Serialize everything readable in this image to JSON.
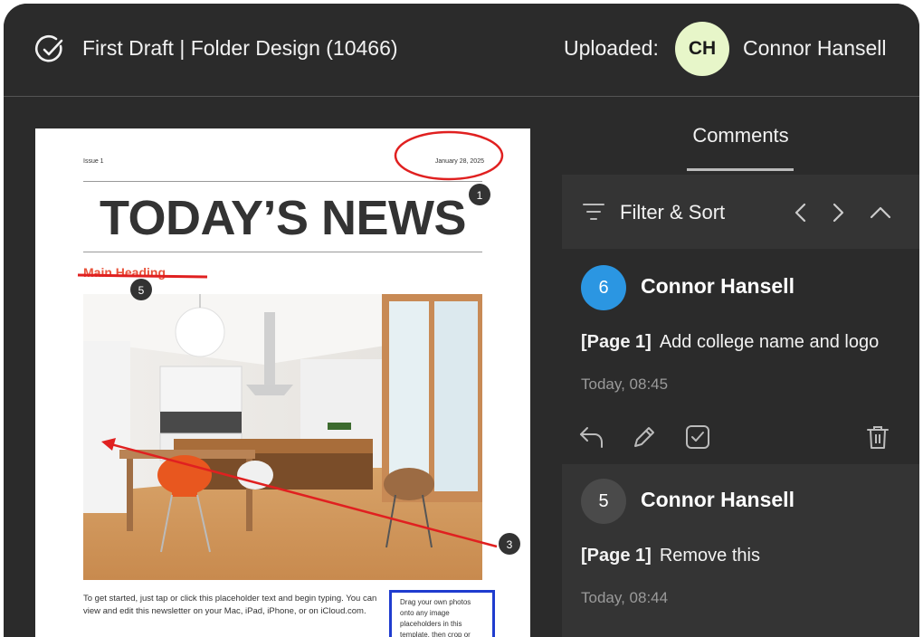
{
  "header": {
    "title": "First Draft | Folder Design (10466)",
    "uploaded_label": "Uploaded:",
    "avatar_initials": "CH",
    "user_name": "Connor Hansell"
  },
  "document": {
    "issue": "Issue 1",
    "date": "January 28, 2025",
    "headline": "TODAY’S NEWS",
    "subheading": "Main Heading",
    "body": "To get started, just tap or click this placeholder text and begin typing. You can view and edit this newsletter on your Mac, iPad, iPhone, or on iCloud.com.",
    "sidebox": "Drag your own photos onto any image placeholders in this template, then crop or",
    "markers": [
      "1",
      "5",
      "3"
    ]
  },
  "comments_panel": {
    "tab_label": "Comments",
    "filter_label": "Filter & Sort",
    "comments": [
      {
        "number": "6",
        "author": "Connor Hansell",
        "page": "[Page 1]",
        "text": "Add college name and logo",
        "time": "Today, 08:45"
      },
      {
        "number": "5",
        "author": "Connor Hansell",
        "page": "[Page 1]",
        "text": "Remove this",
        "time": "Today, 08:44"
      }
    ]
  },
  "colors": {
    "annotation_red": "#e02020",
    "badge_blue": "#2b96e2",
    "avatar_bg": "#e7f6c9"
  },
  "icons": [
    "check-circle-icon",
    "filter-icon",
    "chevron-left-icon",
    "chevron-right-icon",
    "chevron-up-icon",
    "reply-icon",
    "edit-icon",
    "resolve-icon",
    "trash-icon"
  ]
}
